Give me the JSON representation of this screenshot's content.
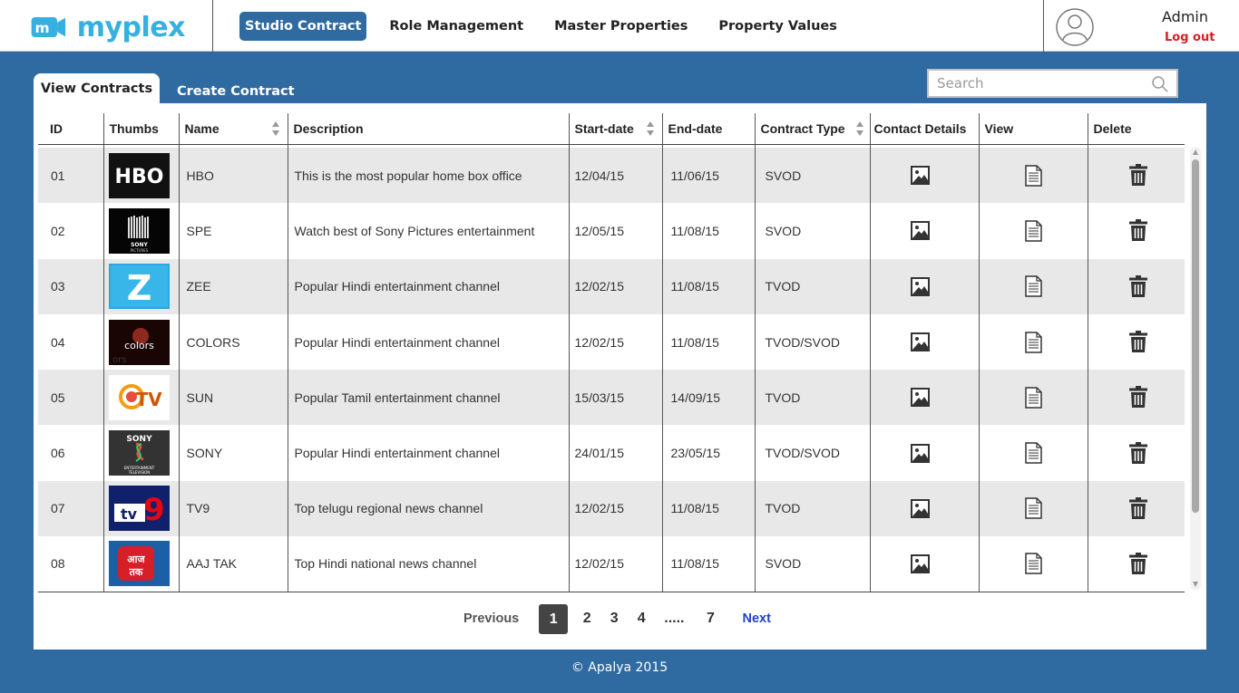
{
  "header": {
    "logo_text": "myplex",
    "nav": [
      {
        "label": "Studio Contract",
        "active": true
      },
      {
        "label": "Role Management",
        "active": false
      },
      {
        "label": "Master Properties",
        "active": false
      },
      {
        "label": "Property Values",
        "active": false
      }
    ],
    "user": {
      "name": "Admin",
      "logout": "Log out"
    }
  },
  "tabs": {
    "view": "View Contracts",
    "create": "Create Contract"
  },
  "search": {
    "placeholder": "Search",
    "value": ""
  },
  "table": {
    "columns": [
      "ID",
      "Thumbs",
      "Name",
      "Description",
      "Start-date",
      "End-date",
      "Contract Type",
      "Contact Details",
      "View",
      "Delete"
    ],
    "sortable": [
      "Name",
      "Start-date",
      "Contract Type"
    ],
    "rows": [
      {
        "id": "01",
        "thumb": "HBO",
        "name": "HBO",
        "description": "This is the most popular home box office",
        "start": "12/04/15",
        "end": "11/06/15",
        "type": "SVOD"
      },
      {
        "id": "02",
        "thumb": "SONY PICTURES",
        "name": "SPE",
        "description": "Watch best of Sony Pictures entertainment",
        "start": "12/05/15",
        "end": "11/08/15",
        "type": "SVOD"
      },
      {
        "id": "03",
        "thumb": "Z",
        "name": "ZEE",
        "description": "Popular Hindi entertainment channel",
        "start": "12/02/15",
        "end": "11/08/15",
        "type": "TVOD"
      },
      {
        "id": "04",
        "thumb": "colors",
        "name": "COLORS",
        "description": "Popular Hindi entertainment channel",
        "start": "12/02/15",
        "end": "11/08/15",
        "type": "TVOD/SVOD"
      },
      {
        "id": "05",
        "thumb": "SUN TV",
        "name": "SUN",
        "description": "Popular Tamil entertainment channel",
        "start": "15/03/15",
        "end": "14/09/15",
        "type": "TVOD"
      },
      {
        "id": "06",
        "thumb": "SONY",
        "name": "SONY",
        "description": "Popular Hindi entertainment channel",
        "start": "24/01/15",
        "end": "23/05/15",
        "type": "TVOD/SVOD"
      },
      {
        "id": "07",
        "thumb": "TV9",
        "name": "TV9",
        "description": "Top telugu regional news channel",
        "start": "12/02/15",
        "end": "11/08/15",
        "type": "TVOD"
      },
      {
        "id": "08",
        "thumb": "AAJ TAK",
        "name": "AAJ TAK",
        "description": "Top Hindi national news channel",
        "start": "12/02/15",
        "end": "11/08/15",
        "type": "SVOD"
      }
    ]
  },
  "pagination": {
    "previous": "Previous",
    "pages": [
      "1",
      "2",
      "3",
      "4"
    ],
    "dots": ".....",
    "last": "7",
    "next": "Next",
    "current": "1"
  },
  "footer": "© Apalya 2015",
  "colors": {
    "brand_blue": "#2f6aa0",
    "logo_blue": "#35b0e0",
    "logout_red": "#d62020",
    "next_link": "#2340c8"
  }
}
